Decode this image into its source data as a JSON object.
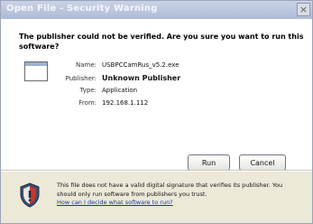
{
  "window": {
    "title": "Open File - Security Warning",
    "close_label": "×"
  },
  "warning": {
    "text": "The publisher could not be verified.  Are you sure you want to run this software?"
  },
  "file": {
    "fields": [
      {
        "label": "Name:",
        "value": "USBPCCamRus_v5.2.exe",
        "emphasis": false
      },
      {
        "label": "Publisher:",
        "value": "Unknown Publisher",
        "emphasis": true
      },
      {
        "label": "Type:",
        "value": "Application",
        "emphasis": false
      },
      {
        "label": "From:",
        "value": "192.168.1.112",
        "emphasis": false
      }
    ]
  },
  "buttons": {
    "run": "Run",
    "cancel": "Cancel"
  },
  "footer": {
    "text": "This file does not have a valid digital signature that verifies its publisher.  You should only run software from publishers you trust.",
    "link": "How can I decide what software to run?"
  }
}
